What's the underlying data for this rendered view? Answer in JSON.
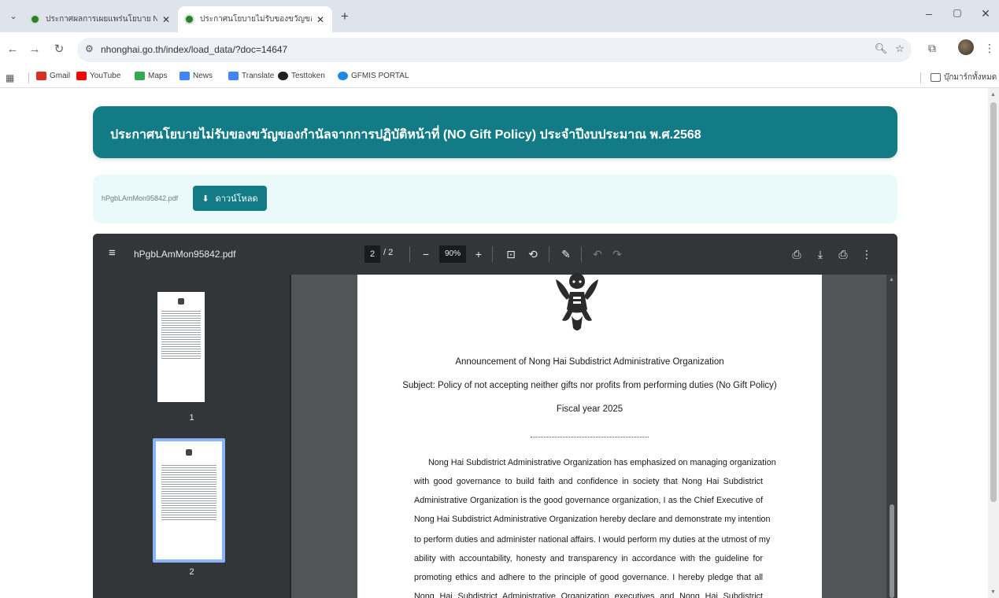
{
  "browser": {
    "tabs": [
      {
        "title": "ประกาศผลการเผยแพร่นโยบาย No Gift",
        "active": false
      },
      {
        "title": "ประกาศนโยบายไม่รับของขวัญของกำนัล",
        "active": true
      }
    ],
    "url": "nhonghai.go.th/index/load_data/?doc=14647",
    "bookmarks": [
      {
        "label": "Gmail",
        "icon": "gmail-icon",
        "color": "#d93025"
      },
      {
        "label": "YouTube",
        "icon": "youtube-icon",
        "color": "#ff0000"
      },
      {
        "label": "Maps",
        "icon": "maps-icon",
        "color": "#34a853"
      },
      {
        "label": "News",
        "icon": "news-icon",
        "color": "#4285f4"
      },
      {
        "label": "Translate",
        "icon": "translate-icon",
        "color": "#4285f4"
      },
      {
        "label": "Testtoken",
        "icon": "testtoken-icon",
        "color": "#202124"
      },
      {
        "label": "GFMIS PORTAL",
        "icon": "gfmis-icon",
        "color": "#1e88e5"
      }
    ],
    "all_bookmarks_label": "บุ๊กมาร์กทั้งหมด"
  },
  "page": {
    "title": "ประกาศนโยบายไม่รับของขวัญของกำนัลจากการปฏิบัติหน้าที่ (NO Gift Policy) ประจำปีงบประมาณ พ.ศ.2568",
    "file_name": "hPgbLAmMon95842.pdf",
    "download_label": "ดาวน์โหลด",
    "accent_color": "#127b86"
  },
  "pdf": {
    "file_name": "hPgbLAmMon95842.pdf",
    "current_page": "2",
    "total_pages": "/ 2",
    "zoom": "90%",
    "thumbnails": [
      "1",
      "2"
    ],
    "doc": {
      "line1": "Announcement of Nong Hai Subdistrict Administrative Organization",
      "line2": "Subject: Policy of not accepting neither gifts nor profits from performing duties (No Gift Policy)",
      "line3": "Fiscal year 2025",
      "paragraph": [
        "Nong Hai Subdistrict Administrative Organization has emphasized on managing organization",
        "with good governance to build faith and confidence in society that Nong Hai Subdistrict",
        "Administrative Organization is the good governance organization, I as the Chief Executive of",
        "Nong Hai Subdistrict Administrative Organization hereby declare and demonstrate my intention",
        "to perform duties and administer national affairs. I would perform my duties at the utmost of my",
        "ability with accountability, honesty and transparency in accordance with the guideline for",
        "promoting ethics and adhere to the principle of good governance. I hereby pledge that all",
        "Nong Hai Subdistrict Administrative Organization executives and Nong Hai Subdistrict"
      ]
    }
  }
}
